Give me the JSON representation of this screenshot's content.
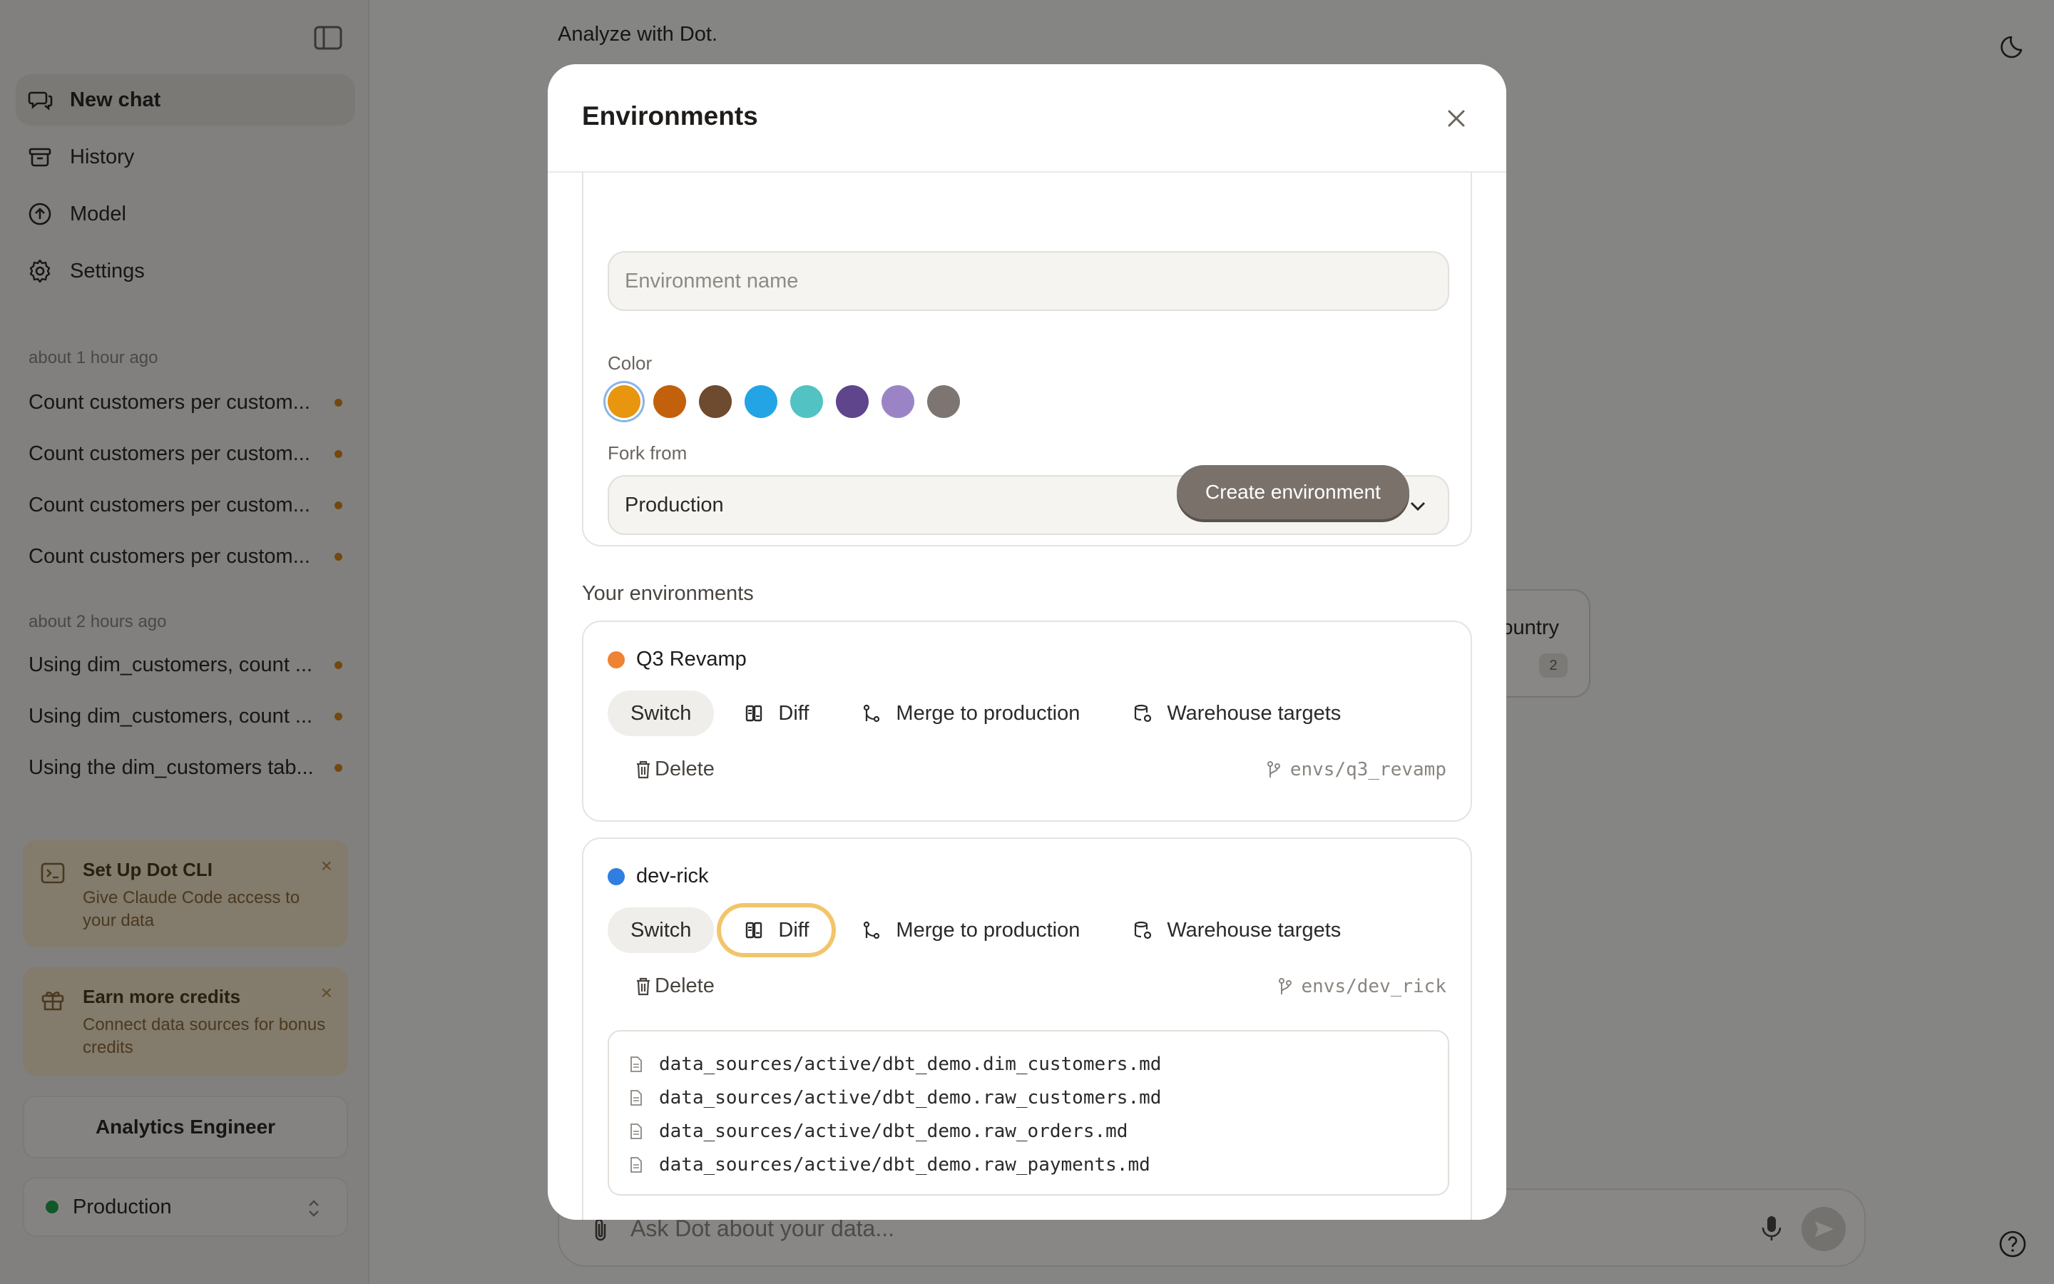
{
  "app": {
    "main_title": "Analyze with Dot."
  },
  "sidebar": {
    "nav": [
      {
        "label": "New chat",
        "icon": "chat-icon"
      },
      {
        "label": "History",
        "icon": "archive-icon"
      },
      {
        "label": "Model",
        "icon": "model-icon"
      },
      {
        "label": "Settings",
        "icon": "gear-icon"
      }
    ],
    "groups": [
      {
        "label": "about 1 hour ago",
        "items": [
          "Count customers per custom...",
          "Count customers per custom...",
          "Count customers per custom...",
          "Count customers per custom..."
        ]
      },
      {
        "label": "about 2 hours ago",
        "items": [
          "Using dim_customers, count ...",
          "Using dim_customers, count ...",
          "Using the dim_customers tab..."
        ]
      }
    ],
    "promos": [
      {
        "title": "Set Up Dot CLI",
        "desc": "Give Claude Code access to your data",
        "close": "×"
      },
      {
        "title": "Earn more credits",
        "desc": "Connect data sources for bonus credits",
        "close": "×"
      }
    ],
    "role": "Analytics Engineer",
    "environment": "Production"
  },
  "chat": {
    "bubble_text": "ountry",
    "bubble_count": "2",
    "input_placeholder": "Ask Dot about your data..."
  },
  "modal": {
    "title": "Environments",
    "name_placeholder": "Environment name",
    "color_label": "Color",
    "colors": [
      "#e8950f",
      "#c2600c",
      "#6e4a2e",
      "#23a4e4",
      "#52c2c2",
      "#5e458c",
      "#9b84c6",
      "#7c7572"
    ],
    "selected_color": "#e8950f",
    "fork_label": "Fork from",
    "fork_value": "Production",
    "create_label": "Create environment",
    "list_label": "Your environments",
    "action_labels": {
      "switch": "Switch",
      "diff": "Diff",
      "merge": "Merge to production",
      "targets": "Warehouse targets",
      "delete": "Delete"
    },
    "environments": [
      {
        "name": "Q3 Revamp",
        "color": "#ee8433",
        "branch": "envs/q3_revamp"
      },
      {
        "name": "dev-rick",
        "color": "#2f7fe0",
        "branch": "envs/dev_rick"
      }
    ],
    "diff_files": [
      "data_sources/active/dbt_demo.dim_customers.md",
      "data_sources/active/dbt_demo.raw_customers.md",
      "data_sources/active/dbt_demo.raw_orders.md",
      "data_sources/active/dbt_demo.raw_payments.md"
    ]
  }
}
